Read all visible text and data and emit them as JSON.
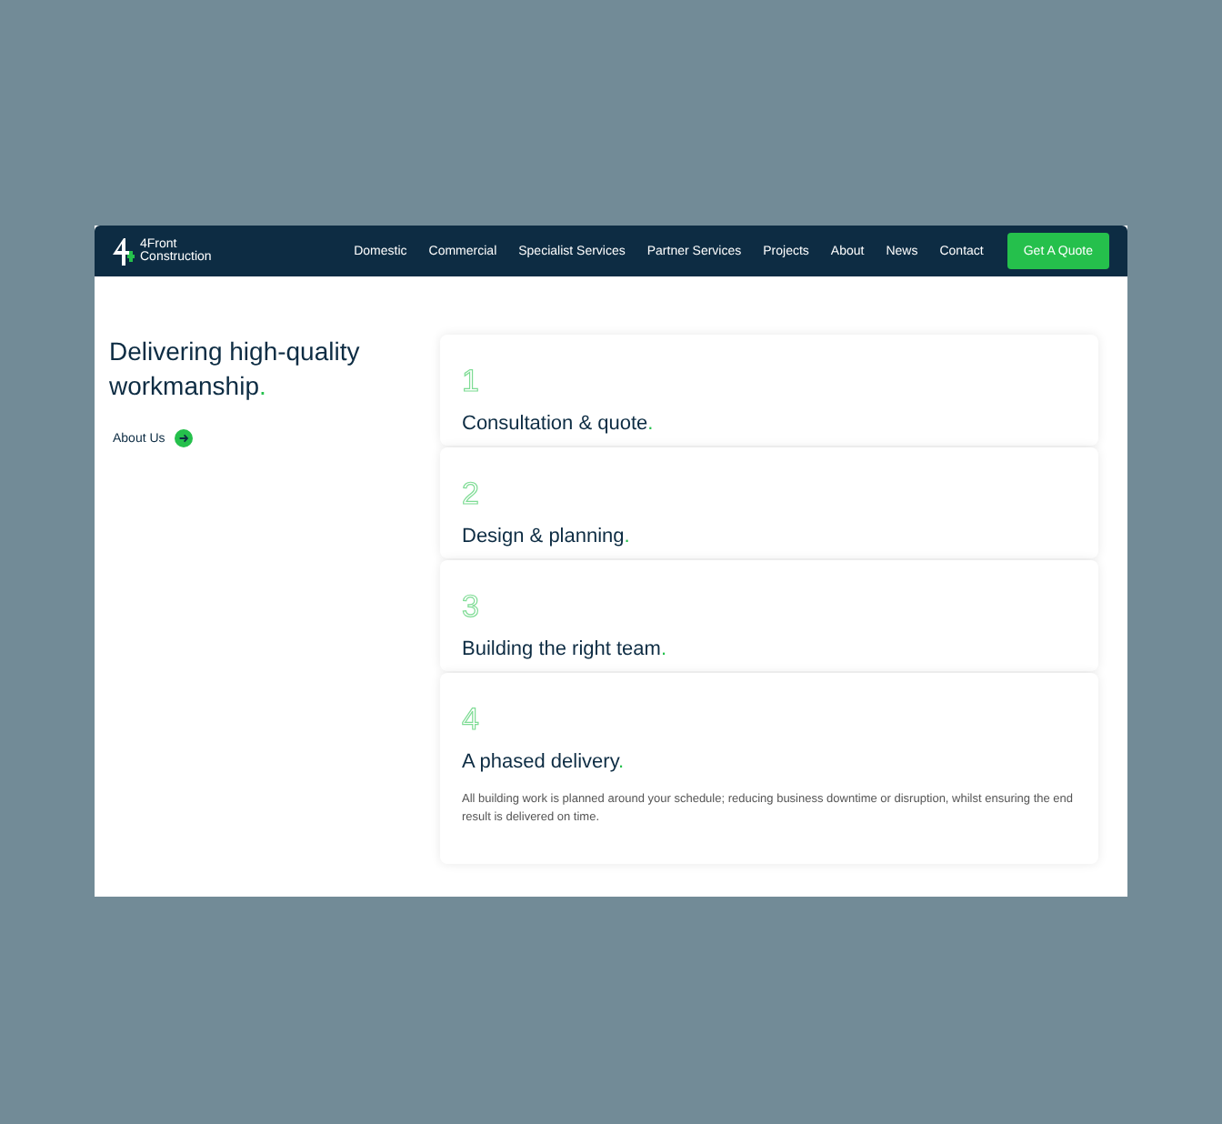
{
  "brand": {
    "line_1": "4Front",
    "line_2": "Construction"
  },
  "nav": [
    {
      "label": "Domestic"
    },
    {
      "label": "Commercial"
    },
    {
      "label": "Specialist Services"
    },
    {
      "label": "Partner Services"
    },
    {
      "label": "Projects"
    },
    {
      "label": "About"
    },
    {
      "label": "News"
    },
    {
      "label": "Contact"
    }
  ],
  "cta": "Get A Quote",
  "intro": {
    "heading": "Delivering high-quality workmanship",
    "heading_end": ".",
    "link": "About Us"
  },
  "steps": [
    {
      "number": "1",
      "title": "Consultation & quote",
      "title_end": ".",
      "expanded": false
    },
    {
      "number": "2",
      "title": "Design & planning",
      "title_end": ".",
      "expanded": false
    },
    {
      "number": "3",
      "title": "Building the right team",
      "title_end": ".",
      "expanded": false
    },
    {
      "number": "4",
      "title": "A phased delivery",
      "title_end": ".",
      "expanded": true,
      "description": "All building work is planned around your schedule; reducing business downtime or disruption, whilst ensuring the end result is delivered on time."
    }
  ]
}
